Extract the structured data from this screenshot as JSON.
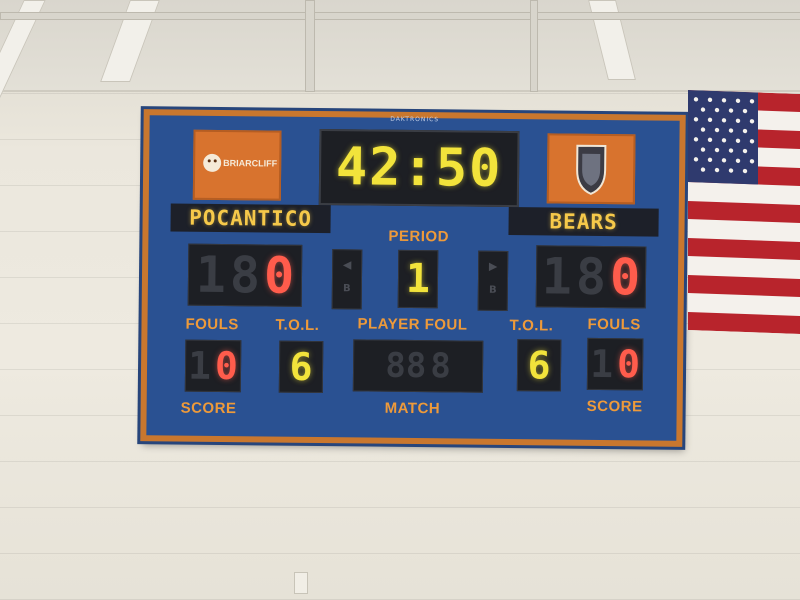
{
  "scoreboard": {
    "brand": "DAKTRONICS",
    "clock": "42:50",
    "home_team": "POCANTICO",
    "away_team": "BEARS",
    "logo_left_text": "BRIARCLIFF",
    "period_label": "PERIOD",
    "period": "1",
    "home_score": "0",
    "away_score": "0",
    "home_fouls": "0",
    "away_fouls": "0",
    "home_tol": "6",
    "away_tol": "6",
    "fouls_label": "FOULS",
    "tol_label": "T.O.L.",
    "player_foul_label": "PLAYER FOUL",
    "score_label": "SCORE",
    "match_label": "MATCH",
    "possession_left": "B",
    "possession_right": "B"
  },
  "colors": {
    "board_blue": "#2a5192",
    "board_orange": "#c9772e",
    "led_yellow": "#f2e33b",
    "led_red": "#ff5c4c",
    "label_orange": "#ee9a3a"
  }
}
